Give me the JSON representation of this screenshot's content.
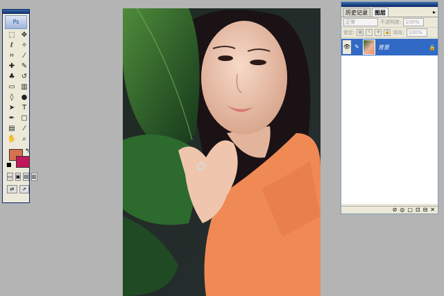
{
  "tools_palette": {
    "logo_text": "Ps",
    "tools": [
      {
        "name": "marquee-icon",
        "glyph": "⬚"
      },
      {
        "name": "move-icon",
        "glyph": "✥"
      },
      {
        "name": "lasso-icon",
        "glyph": "ℓ"
      },
      {
        "name": "magic-wand-icon",
        "glyph": "✧"
      },
      {
        "name": "crop-icon",
        "glyph": "⌗"
      },
      {
        "name": "slice-icon",
        "glyph": "⁄"
      },
      {
        "name": "healing-brush-icon",
        "glyph": "✚"
      },
      {
        "name": "brush-icon",
        "glyph": "✎"
      },
      {
        "name": "clone-stamp-icon",
        "glyph": "♣"
      },
      {
        "name": "history-brush-icon",
        "glyph": "↺"
      },
      {
        "name": "eraser-icon",
        "glyph": "▭"
      },
      {
        "name": "gradient-icon",
        "glyph": "▥"
      },
      {
        "name": "blur-icon",
        "glyph": "◊"
      },
      {
        "name": "dodge-icon",
        "glyph": "●"
      },
      {
        "name": "path-select-icon",
        "glyph": "➤"
      },
      {
        "name": "type-icon",
        "glyph": "T"
      },
      {
        "name": "pen-icon",
        "glyph": "✒"
      },
      {
        "name": "shape-icon",
        "glyph": "▢"
      },
      {
        "name": "notes-icon",
        "glyph": "▤"
      },
      {
        "name": "eyedropper-icon",
        "glyph": "⁄"
      },
      {
        "name": "hand-icon",
        "glyph": "✋"
      },
      {
        "name": "zoom-icon",
        "glyph": "⌕"
      }
    ],
    "fg_color": "#d6714f",
    "bg_color": "#c2185b",
    "mode_buttons": [
      "▭",
      "▣",
      "▤",
      "▥"
    ],
    "extra_buttons": [
      "⇄",
      "⇗"
    ]
  },
  "layers_panel": {
    "tabs": [
      "历史记录",
      "图层"
    ],
    "active_tab": 1,
    "tab_menu": "▸",
    "blend_mode": "正常",
    "opacity_label": "不透明度:",
    "opacity_value": "100%",
    "lock_label": "锁定:",
    "fill_label": "填充:",
    "fill_value": "100%",
    "layers": [
      {
        "name": "背景",
        "locked": true,
        "visible": true
      }
    ],
    "bottom_icons": [
      "⊘",
      "◎",
      "▢",
      "⊡",
      "⊟",
      "✕"
    ],
    "accent": "#316ac5"
  }
}
